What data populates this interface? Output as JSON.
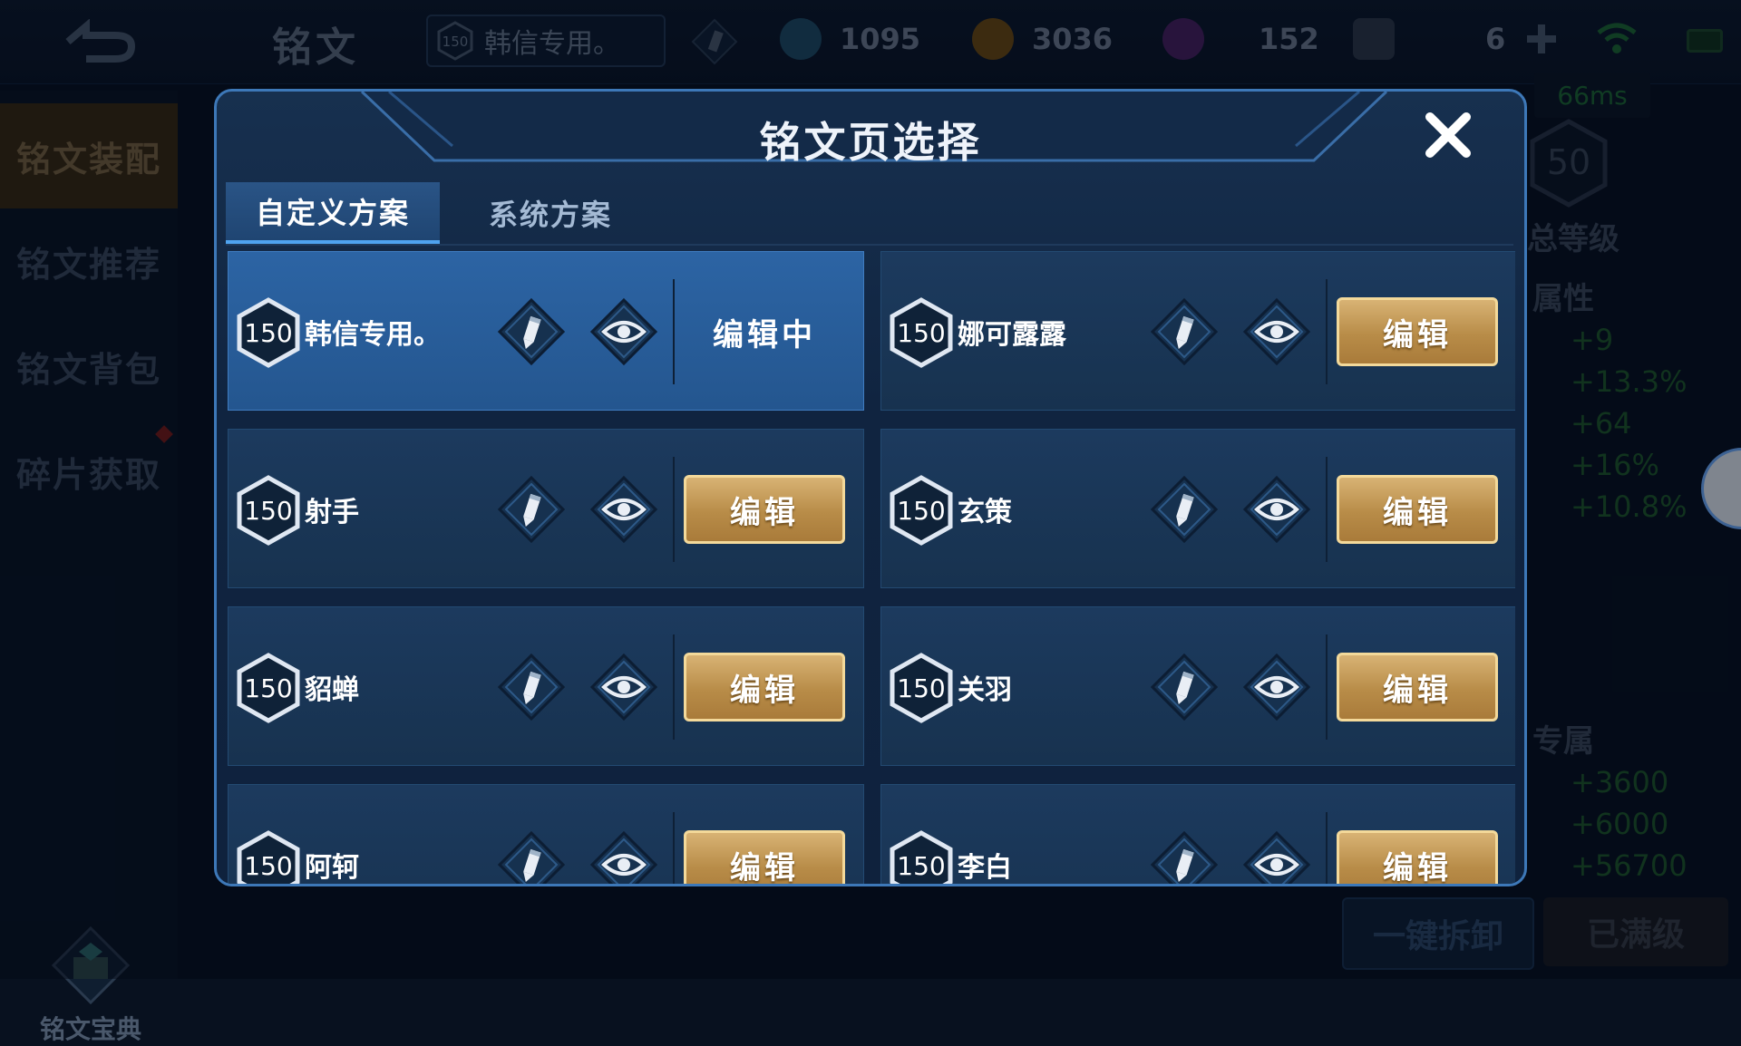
{
  "topbar": {
    "title": "铭文",
    "current_plan": {
      "level": "150",
      "name": "韩信专用。"
    },
    "resources": [
      {
        "icon": "crystal-icon",
        "value": "1095",
        "color": "#3d8fb8"
      },
      {
        "icon": "gold-coin-icon",
        "value": "3036",
        "color": "#c98a1c"
      },
      {
        "icon": "gem-icon",
        "value": "152",
        "color": "#8a3ab0"
      },
      {
        "icon": "card-icon",
        "value": "6",
        "color": "#6a7a8e"
      }
    ],
    "latency": "66ms"
  },
  "leftnav": {
    "items": [
      "铭文装配",
      "铭文推荐",
      "铭文背包",
      "碎片获取"
    ],
    "codex_label": "铭文宝典"
  },
  "rightpanel": {
    "level_badge": "50",
    "total_level_label": "总等级",
    "attr_label": "属性",
    "stats": [
      "+9",
      "+13.3%",
      "+64",
      "+16%",
      "+10.8%"
    ],
    "exclusive_label": "专属",
    "stats2": [
      "+3600",
      "+6000",
      "+56700"
    ],
    "dismantle_label": "一键拆卸",
    "maxed_label": "已满级"
  },
  "modal": {
    "title": "铭文页选择",
    "tabs": [
      "自定义方案",
      "系统方案"
    ],
    "edit_label": "编辑",
    "editing_label": "编辑中",
    "pages": [
      {
        "level": "150",
        "name": "韩信专用。",
        "current": true
      },
      {
        "level": "150",
        "name": "娜可露露",
        "current": false
      },
      {
        "level": "150",
        "name": "射手",
        "current": false
      },
      {
        "level": "150",
        "name": "玄策",
        "current": false
      },
      {
        "level": "150",
        "name": "貂蝉",
        "current": false
      },
      {
        "level": "150",
        "name": "关羽",
        "current": false
      },
      {
        "level": "150",
        "name": "阿轲",
        "current": false
      },
      {
        "level": "150",
        "name": "李白",
        "current": false
      }
    ]
  }
}
